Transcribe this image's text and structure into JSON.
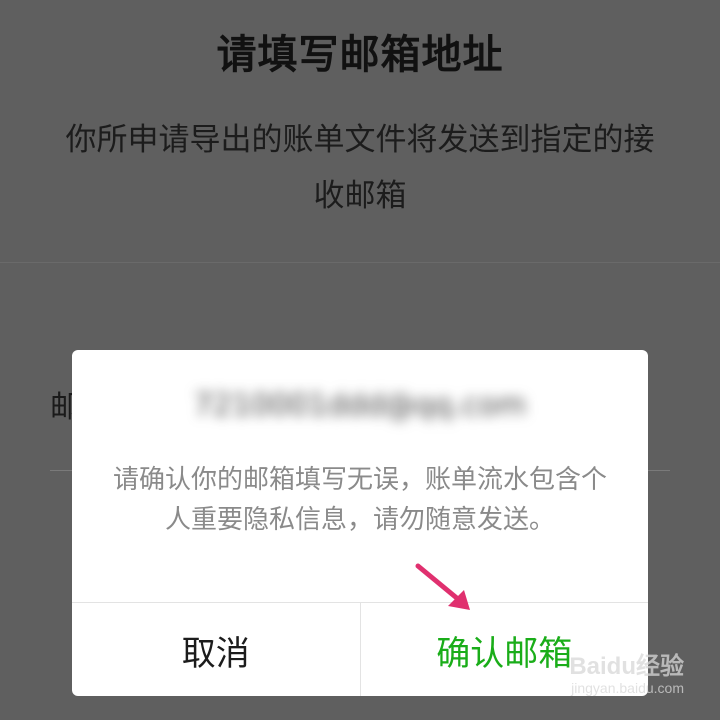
{
  "page": {
    "title": "请填写邮箱地址",
    "description": "你所申请导出的账单文件将发送到指定的接收邮箱",
    "email_label": "邮"
  },
  "dialog": {
    "email_value": "7210001ddd@qq.com",
    "message": "请确认你的邮箱填写无误，账单流水包含个人重要隐私信息，请勿随意发送。",
    "cancel_label": "取消",
    "confirm_label": "确认邮箱"
  },
  "watermark": {
    "brand": "Baidu经验",
    "site": "jingyan.baidu.com"
  },
  "colors": {
    "confirm": "#1aad19",
    "arrow": "#e0306f",
    "scrim": "#5f5f5f"
  },
  "icons": {
    "annotation": "arrow-icon"
  }
}
